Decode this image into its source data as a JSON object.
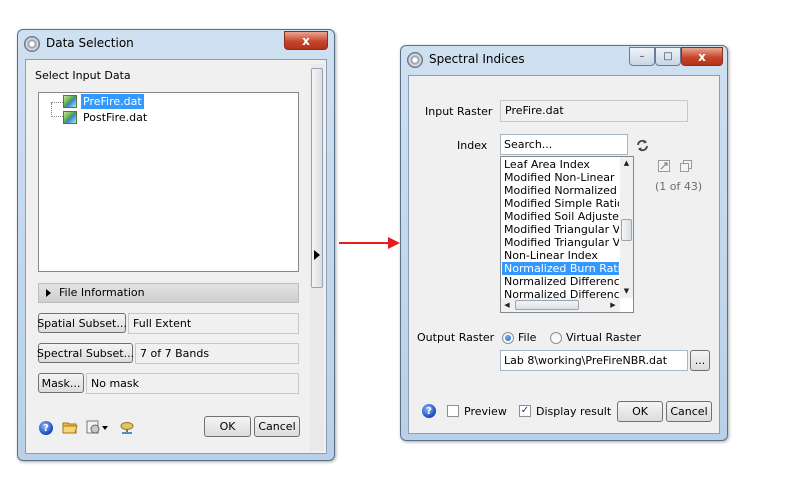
{
  "data_selection": {
    "title": "Data Selection",
    "close_glyph": "x",
    "select_label": "Select Input Data",
    "tree_items": [
      {
        "label": "PreFire.dat",
        "selected": true
      },
      {
        "label": "PostFire.dat",
        "selected": false
      }
    ],
    "file_info_label": "File Information",
    "spatial_subset_label": "Spatial Subset...",
    "spatial_subset_value": "Full Extent",
    "spectral_subset_label": "Spectral Subset...",
    "spectral_subset_value": "7 of 7 Bands",
    "mask_label": "Mask...",
    "mask_value": "No mask",
    "ok_label": "OK",
    "cancel_label": "Cancel",
    "help_glyph": "?"
  },
  "spectral_indices": {
    "title": "Spectral Indices",
    "minimize_glyph": "–",
    "maximize_glyph": "□",
    "close_glyph": "x",
    "input_raster_label": "Input Raster",
    "input_raster_value": "PreFire.dat",
    "index_label": "Index",
    "search_value": "Search...",
    "index_items": [
      "Leaf Area Index",
      "Modified Non-Linear Index",
      "Modified Normalized Differer",
      "Modified Simple Ratio",
      "Modified Soil Adjusted Vege",
      "Modified Triangular Vegetati",
      "Modified Triangular Vegetati",
      "Non-Linear Index",
      "Normalized Burn Ratio",
      "Normalized Difference Built-I",
      "Normalized Difference Snow"
    ],
    "selected_index": "Normalized Burn Ratio",
    "count_text": "(1 of 43)",
    "output_raster_label": "Output Raster",
    "radio_file_label": "File",
    "radio_virtual_label": "Virtual Raster",
    "output_path": "Lab 8\\working\\PreFireNBR.dat",
    "browse_label": "...",
    "preview_label": "Preview",
    "display_result_label": "Display result",
    "ok_label": "OK",
    "cancel_label": "Cancel",
    "help_glyph": "?",
    "check_glyph": "✓"
  },
  "colors": {
    "arrow": "#e51d1d",
    "selection": "#3399ff"
  }
}
